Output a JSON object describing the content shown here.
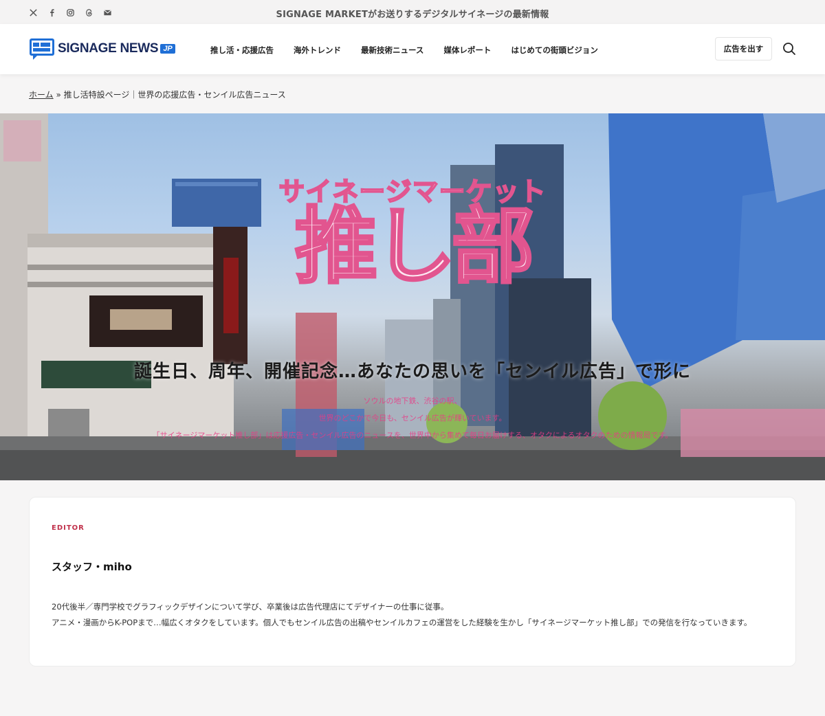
{
  "topbar": {
    "social_icons": [
      "x-icon",
      "facebook-icon",
      "instagram-icon",
      "threads-icon",
      "mail-icon"
    ],
    "tagline": "SIGNAGE MARKETがお送りするデジタルサイネージの最新情報"
  },
  "header": {
    "logo_text": "SIGNAGE NEWS",
    "logo_badge": "JP",
    "nav": [
      "推し活・応援広告",
      "海外トレンド",
      "最新技術ニュース",
      "媒体レポート",
      "はじめての街頭ビジョン"
    ],
    "ad_button": "広告を出す",
    "search_icon": "search-icon"
  },
  "breadcrumb": {
    "home": "ホーム",
    "separator": "»",
    "current": "推し活特設ページ｜世界の応援広告・センイル広告ニュース"
  },
  "hero": {
    "katakana": "サイネージマーケット",
    "kanji": "推し部",
    "subtitle": "誕生日、周年、開催記念…あなたの思いを「センイル広告」で形に",
    "desc_lines": [
      "ソウルの地下鉄、渋谷の駅、",
      "世界のどこかで今日も、センイル広告が輝いています。",
      "「サイネージマーケット推し部」は応援広告・センイル広告のニュースを、世界中から集めて毎日お届けする、オタクによるオタクのための情報局です。"
    ],
    "colors": {
      "accent": "#e2558f",
      "fill": "#fde8f2"
    }
  },
  "editor": {
    "label": "EDITOR",
    "name": "スタッフ・miho",
    "bio_line1": "20代後半／専門学校でグラフィックデザインについて学び、卒業後は広告代理店にてデザイナーの仕事に従事。",
    "bio_line2": "アニメ・漫画からK-POPまで…幅広くオタクをしています。個人でもセンイル広告の出稿やセンイルカフェの運営をした経験を生かし「サイネージマーケット推し部」での発信を行なっていきます。"
  }
}
